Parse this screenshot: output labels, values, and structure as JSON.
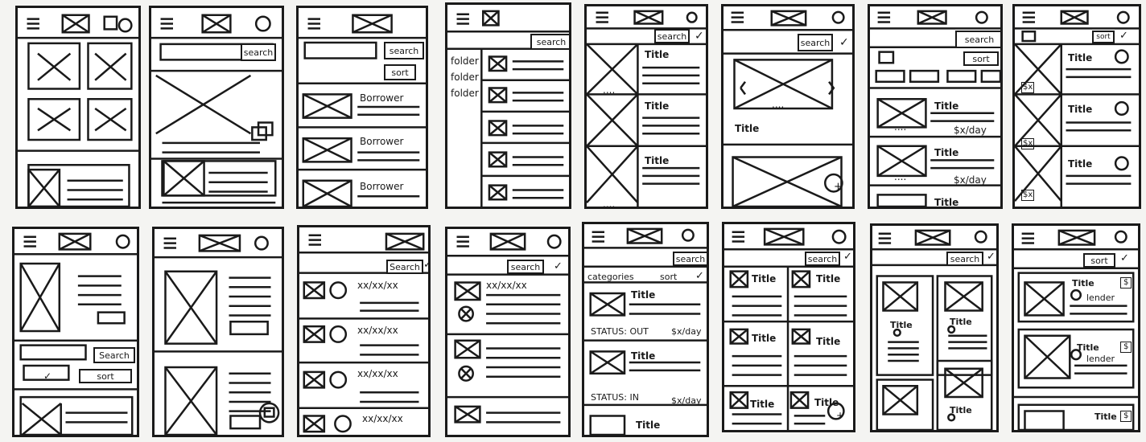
{
  "labels": {
    "search": "search",
    "search_cap": "Search",
    "sort": "sort",
    "title": "Title",
    "borrower": "Borrower",
    "folder": "folder",
    "price": "$x/day",
    "date": "xx/xx/xx",
    "categories": "categories",
    "status_out": "STATUS: OUT",
    "status_in": "STATUS: IN",
    "lender": "lender",
    "ellipsis": "....",
    "dollar": "$",
    "dollar_x": "$x",
    "check": "✓",
    "plus": "+"
  }
}
